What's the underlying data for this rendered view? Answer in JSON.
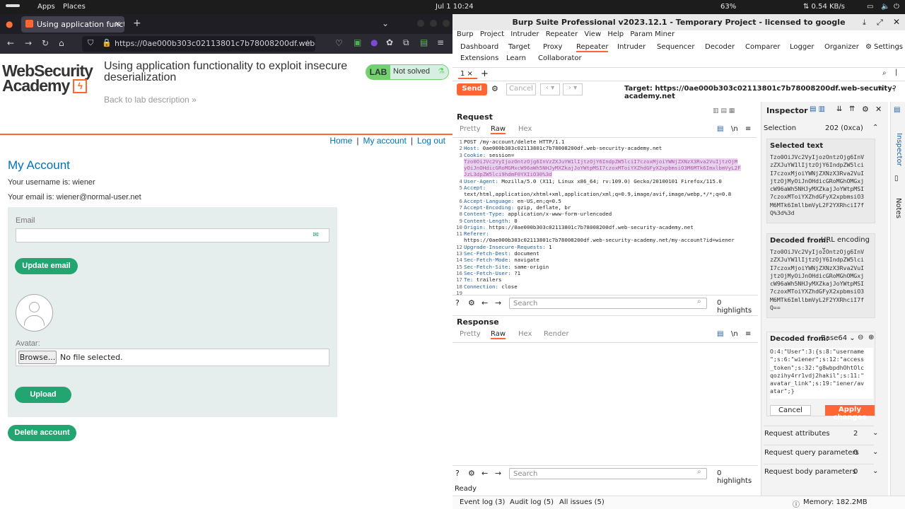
{
  "topbar": {
    "apps": "Apps",
    "places": "Places",
    "clock": "Jul 1  10:24",
    "battery": "63%",
    "net": "⇅ 0.54 KB/s"
  },
  "firefox": {
    "tab_title": "Using application functio",
    "new_tab": "+",
    "url": "https://0ae000b303c02113801c7b78008200df.web-secu"
  },
  "lab": {
    "brand_line1": "WebSecurity",
    "brand_line2": "Academy",
    "title": "Using application functionality to exploit insecure deserialization",
    "back": "Back to lab description  »",
    "badge": "LAB",
    "status": "Not solved"
  },
  "nav": {
    "home": "Home",
    "sep": "|",
    "account": "My account",
    "logout": "Log out"
  },
  "account": {
    "heading": "My Account",
    "username": "Your username is: wiener",
    "email": "Your email is: wiener@normal-user.net",
    "email_label": "Email",
    "update_btn": "Update email",
    "avatar_label": "Avatar:",
    "browse_btn": "Browse...",
    "file_text": "No file selected.",
    "upload_btn": "Upload",
    "delete_btn": "Delete account"
  },
  "burp": {
    "title": "Burp Suite Professional v2023.12.1 - Temporary Project - licensed to google",
    "menu": [
      "Burp",
      "Project",
      "Intruder",
      "Repeater",
      "View",
      "Help",
      "Param Miner"
    ],
    "tabs": [
      "Dashboard",
      "Target",
      "Proxy",
      "Repeater",
      "Intruder",
      "Sequencer",
      "Decoder",
      "Comparer",
      "Logger",
      "Organizer",
      "Settings"
    ],
    "tabs2": [
      "Extensions",
      "Learn",
      "Collaborator"
    ],
    "repeater_tab": "1",
    "send": "Send",
    "cancel": "Cancel",
    "target": "Target: https://0ae000b303c02113801c7b78008200df.web-security-academy.net",
    "request_title": "Request",
    "response_title": "Response",
    "req_tabs": [
      "Pretty",
      "Raw",
      "Hex"
    ],
    "resp_tabs": [
      "Pretty",
      "Raw",
      "Hex",
      "Render"
    ],
    "newline": "\\n",
    "request_lines": [
      {
        "n": "1",
        "k": "",
        "v": "POST /my-account/delete HTTP/1.1"
      },
      {
        "n": "2",
        "k": "Host:",
        "v": " 0ae000b303c02113801c7b78008200df.web-security-academy.net"
      },
      {
        "n": "3",
        "k": "Cookie:",
        "v": " session="
      },
      {
        "n": "",
        "k": "",
        "v": "Tzo0OiJVc2VyIjozOntzOjg6InVzZXJuYW1lIjtzOjY6IndpZW5lciI7czoxMjoiYWNjZXNzX3Rva2VuIjtzOjM",
        "h": true
      },
      {
        "n": "",
        "k": "",
        "v": "yOiJnOHdicGRoMGMxcW96aWh5NHJyMXZkajJoYWtpMSI7czoxMToiYXZhdGFyX2xpbmsiO3M6MTk6ImxlbmVyL2F",
        "h": true
      },
      {
        "n": "",
        "k": "",
        "v": "JzL3dpZW5lci9hdmF0YXIiO30%3d",
        "h": true
      },
      {
        "n": "4",
        "k": "User-Agent:",
        "v": " Mozilla/5.0 (X11; Linux x86_64; rv:109.0) Gecko/20100101 Firefox/115.0"
      },
      {
        "n": "5",
        "k": "Accept:",
        "v": ""
      },
      {
        "n": "",
        "k": "",
        "v": "text/html,application/xhtml+xml,application/xml;q=0.9,image/avif,image/webp,*/*;q=0.8"
      },
      {
        "n": "6",
        "k": "Accept-Language:",
        "v": " en-US,en;q=0.5"
      },
      {
        "n": "7",
        "k": "Accept-Encoding:",
        "v": " gzip, deflate, br"
      },
      {
        "n": "8",
        "k": "Content-Type:",
        "v": " application/x-www-form-urlencoded"
      },
      {
        "n": "9",
        "k": "Content-Length:",
        "v": " 0"
      },
      {
        "n": "10",
        "k": "Origin:",
        "v": " https://0ae000b303c02113801c7b78008200df.web-security-academy.net"
      },
      {
        "n": "11",
        "k": "Referer:",
        "v": ""
      },
      {
        "n": "",
        "k": "",
        "v": "https://0ae000b303c02113801c7b78008200df.web-security-academy.net/my-account?id=wiener"
      },
      {
        "n": "12",
        "k": "Upgrade-Insecure-Requests:",
        "v": " 1"
      },
      {
        "n": "13",
        "k": "Sec-Fetch-Dest:",
        "v": " document"
      },
      {
        "n": "14",
        "k": "Sec-Fetch-Mode:",
        "v": " navigate"
      },
      {
        "n": "15",
        "k": "Sec-Fetch-Site:",
        "v": " same-origin"
      },
      {
        "n": "16",
        "k": "Sec-Fetch-User:",
        "v": " ?1"
      },
      {
        "n": "17",
        "k": "Te:",
        "v": " trailers"
      },
      {
        "n": "18",
        "k": "Connection:",
        "v": " close"
      },
      {
        "n": "19",
        "k": "",
        "v": ""
      }
    ],
    "search_placeholder": "Search",
    "highlights": "0 highlights",
    "inspector": {
      "title": "Inspector",
      "selection_label": "Selection",
      "selection_value": "202 (0xca)",
      "selected_text_label": "Selected text",
      "selected_text": "Tzo0OiJVc2VyIjozOntzOjg6InV\nzZXJuYW1lIjtzOjY6IndpZW5lci\nI7czoxMjoiYWNjZXNzX3Rva2VuI\njtzOjMyOiJnOHdicGRoMGhOMGxj\ncW96aWh5NHJyMXZkajJoYWtpMSI\n7czoxMToiYXZhdGFyX2xpbmsiO3\nM6MTk6ImllbmVyL2F2YXRhciI7f\nQ%3d%3d",
      "decoded1_label": "Decoded from:",
      "decoded1_type": "URL encoding",
      "decoded1": "Tzo0OiJVc2VyIjozOntzOjg6InV\nzZXJuYW1lIjtzOjY6IndpZW5lci\nI7czoxMjoiYWNjZXNzX3Rva2VuI\njtzOjMyOiJnOHdicGRoMGhOMGxj\ncW96aWh5NHJyMXZkajJoYWtpMSI\n7czoxMToiYXZhdGFyX2xpbmsiO3\nM6MTk6ImllbmVyL2F2YXRhciI7f\nQ==",
      "decoded2_label": "Decoded from:",
      "decoded2_type": "Base64",
      "decoded2": "O:4:\"User\":3:{s:8:\"username\n\";s:6:\"wiener\";s:12:\"access\n_token\";s:32:\"g8wbpdhOhtOlc\nqozihy4rr1vdj2hakil\";s:11:\"\navatar_link\";s:19:\"iener/av\natar\";}",
      "cancel": "Cancel",
      "apply": "Apply changes",
      "attrs": [
        {
          "label": "Request attributes",
          "count": "2"
        },
        {
          "label": "Request query parameters",
          "count": "0"
        },
        {
          "label": "Request body parameters",
          "count": "0"
        }
      ]
    },
    "rail": [
      "Inspector",
      "Notes"
    ],
    "status": "Ready",
    "bottom": {
      "event": "Event log (3)",
      "audit": "Audit log (5)",
      "issues": "All issues (5)",
      "memory": "Memory: 182.2MB"
    }
  }
}
